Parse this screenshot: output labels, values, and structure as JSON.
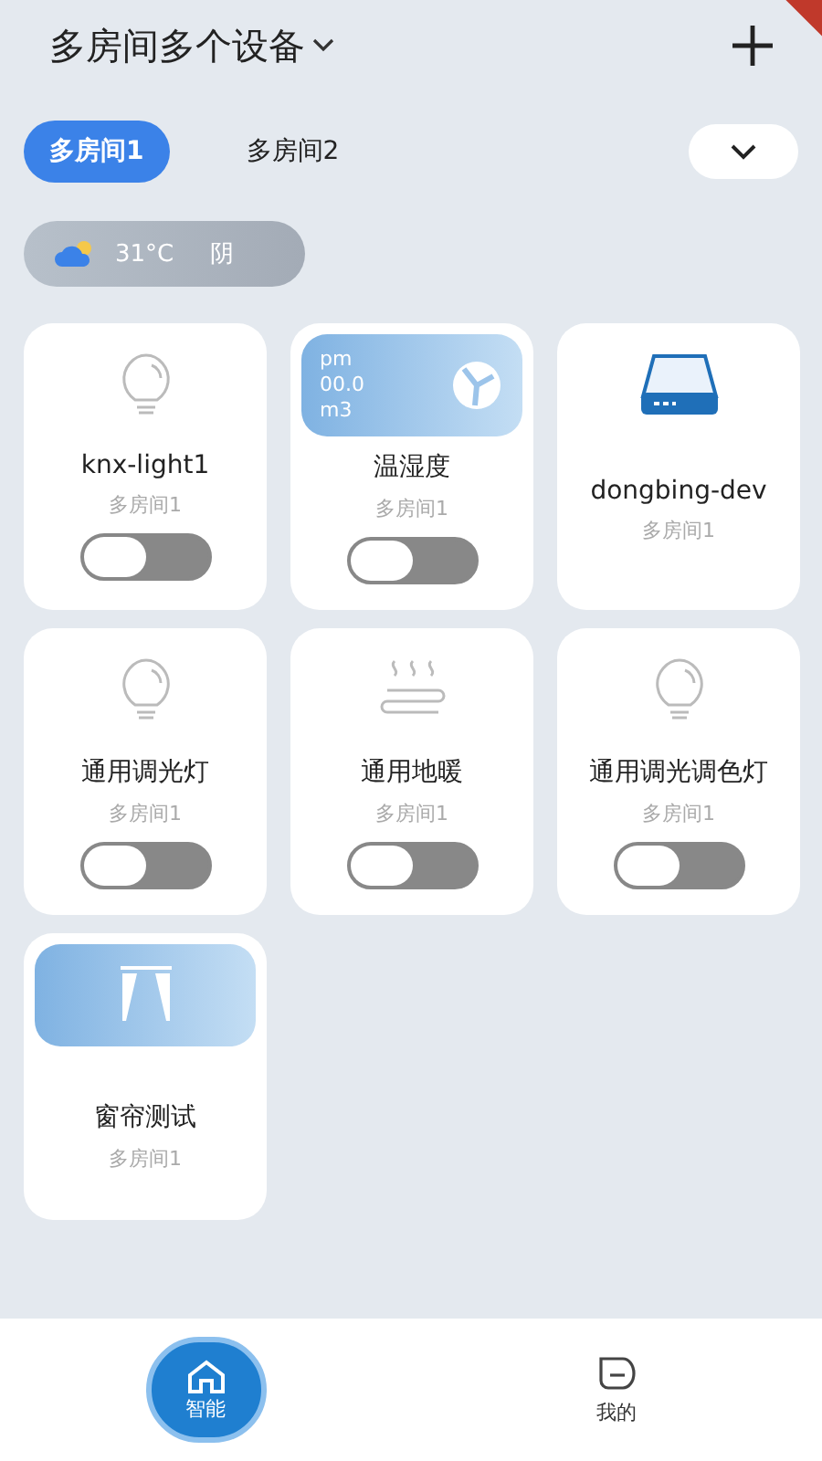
{
  "header": {
    "title": "多房间多个设备"
  },
  "rooms": [
    {
      "label": "多房间1",
      "selected": true
    },
    {
      "label": "多房间2",
      "selected": false
    }
  ],
  "weather": {
    "temperature": "31°C",
    "condition": "阴"
  },
  "devices": [
    {
      "kind": "light",
      "name": "knx-light1",
      "room": "多房间1",
      "on": false
    },
    {
      "kind": "sensor",
      "name": "温湿度",
      "room": "多房间1",
      "on": false,
      "banner": [
        "pm",
        "00.0",
        "m3"
      ]
    },
    {
      "kind": "gateway",
      "name": "dongbing-dev",
      "room": "多房间1"
    },
    {
      "kind": "light",
      "name": "通用调光灯",
      "room": "多房间1",
      "on": false
    },
    {
      "kind": "heater",
      "name": "通用地暖",
      "room": "多房间1",
      "on": false
    },
    {
      "kind": "light",
      "name": "通用调光调色灯",
      "room": "多房间1",
      "on": false
    },
    {
      "kind": "curtain",
      "name": "窗帘测试",
      "room": "多房间1"
    }
  ],
  "nav": [
    {
      "label": "智能",
      "selected": true
    },
    {
      "label": "我的",
      "selected": false
    }
  ]
}
